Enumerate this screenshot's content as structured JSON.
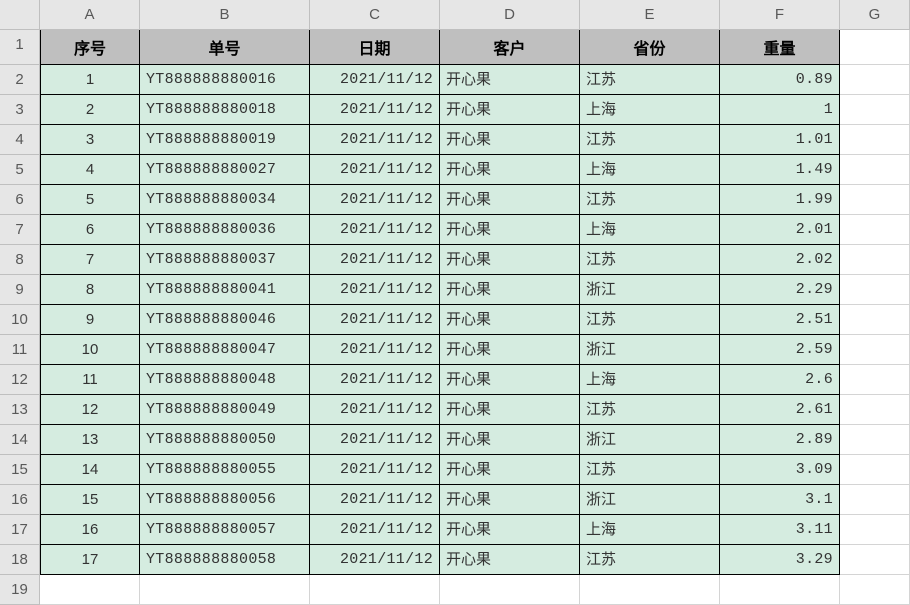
{
  "columns": [
    "A",
    "B",
    "C",
    "D",
    "E",
    "F",
    "G"
  ],
  "headers": {
    "A": "序号",
    "B": "单号",
    "C": "日期",
    "D": "客户",
    "E": "省份",
    "F": "重量"
  },
  "row_numbers": [
    "1",
    "2",
    "3",
    "4",
    "5",
    "6",
    "7",
    "8",
    "9",
    "10",
    "11",
    "12",
    "13",
    "14",
    "15",
    "16",
    "17",
    "18",
    "19"
  ],
  "rows": [
    {
      "seq": "1",
      "order": "YT888888880016",
      "date": "2021/11/12",
      "cust": "开心果",
      "prov": "江苏",
      "wt": "0.89"
    },
    {
      "seq": "2",
      "order": "YT888888880018",
      "date": "2021/11/12",
      "cust": "开心果",
      "prov": "上海",
      "wt": "1"
    },
    {
      "seq": "3",
      "order": "YT888888880019",
      "date": "2021/11/12",
      "cust": "开心果",
      "prov": "江苏",
      "wt": "1.01"
    },
    {
      "seq": "4",
      "order": "YT888888880027",
      "date": "2021/11/12",
      "cust": "开心果",
      "prov": "上海",
      "wt": "1.49"
    },
    {
      "seq": "5",
      "order": "YT888888880034",
      "date": "2021/11/12",
      "cust": "开心果",
      "prov": "江苏",
      "wt": "1.99"
    },
    {
      "seq": "6",
      "order": "YT888888880036",
      "date": "2021/11/12",
      "cust": "开心果",
      "prov": "上海",
      "wt": "2.01"
    },
    {
      "seq": "7",
      "order": "YT888888880037",
      "date": "2021/11/12",
      "cust": "开心果",
      "prov": "江苏",
      "wt": "2.02"
    },
    {
      "seq": "8",
      "order": "YT888888880041",
      "date": "2021/11/12",
      "cust": "开心果",
      "prov": "浙江",
      "wt": "2.29"
    },
    {
      "seq": "9",
      "order": "YT888888880046",
      "date": "2021/11/12",
      "cust": "开心果",
      "prov": "江苏",
      "wt": "2.51"
    },
    {
      "seq": "10",
      "order": "YT888888880047",
      "date": "2021/11/12",
      "cust": "开心果",
      "prov": "浙江",
      "wt": "2.59"
    },
    {
      "seq": "11",
      "order": "YT888888880048",
      "date": "2021/11/12",
      "cust": "开心果",
      "prov": "上海",
      "wt": "2.6"
    },
    {
      "seq": "12",
      "order": "YT888888880049",
      "date": "2021/11/12",
      "cust": "开心果",
      "prov": "江苏",
      "wt": "2.61"
    },
    {
      "seq": "13",
      "order": "YT888888880050",
      "date": "2021/11/12",
      "cust": "开心果",
      "prov": "浙江",
      "wt": "2.89"
    },
    {
      "seq": "14",
      "order": "YT888888880055",
      "date": "2021/11/12",
      "cust": "开心果",
      "prov": "江苏",
      "wt": "3.09"
    },
    {
      "seq": "15",
      "order": "YT888888880056",
      "date": "2021/11/12",
      "cust": "开心果",
      "prov": "浙江",
      "wt": "3.1"
    },
    {
      "seq": "16",
      "order": "YT888888880057",
      "date": "2021/11/12",
      "cust": "开心果",
      "prov": "上海",
      "wt": "3.11"
    },
    {
      "seq": "17",
      "order": "YT888888880058",
      "date": "2021/11/12",
      "cust": "开心果",
      "prov": "江苏",
      "wt": "3.29"
    }
  ]
}
